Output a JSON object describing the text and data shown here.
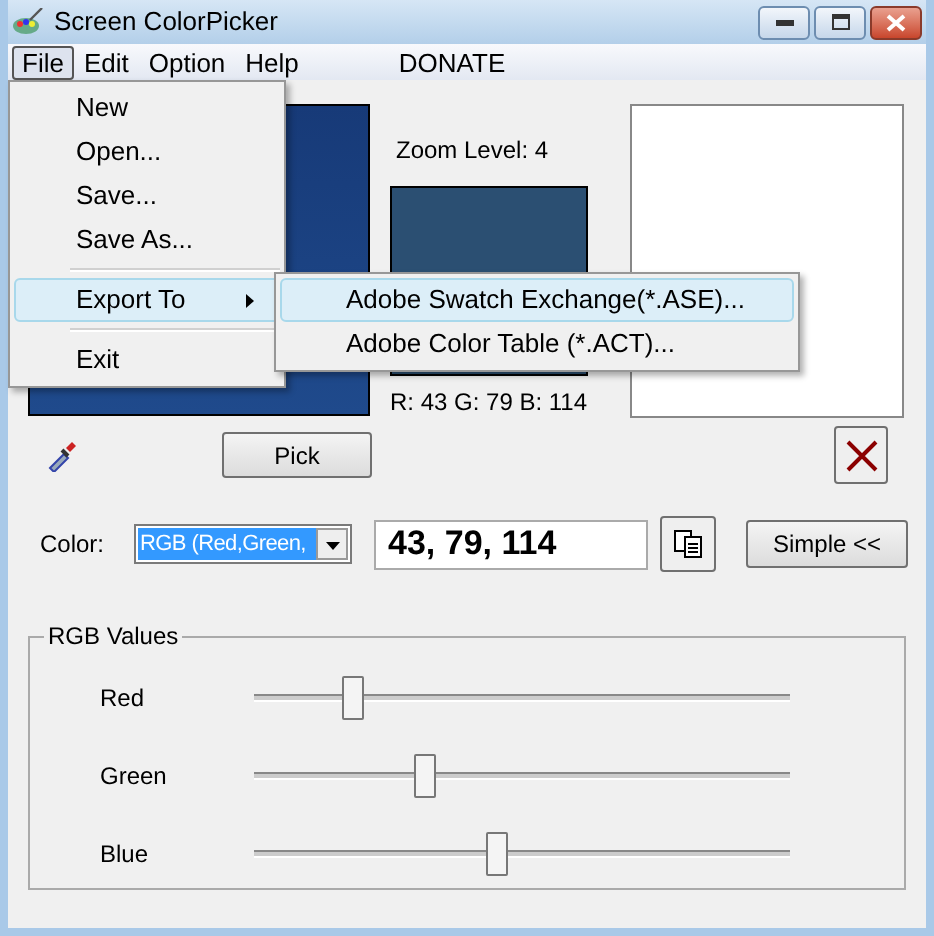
{
  "window": {
    "title": "Screen ColorPicker"
  },
  "menu_bar": [
    {
      "label": "File",
      "selected": true
    },
    {
      "label": "Edit",
      "selected": false
    },
    {
      "label": "Option",
      "selected": false
    },
    {
      "label": "Help",
      "selected": false
    },
    {
      "label": "DONATE",
      "selected": false
    }
  ],
  "file_menu": [
    {
      "kind": "item",
      "label": "New",
      "selected": false
    },
    {
      "kind": "item",
      "label": "Open...",
      "selected": false
    },
    {
      "kind": "item",
      "label": "Save...",
      "selected": false
    },
    {
      "kind": "item",
      "label": "Save As...",
      "selected": false
    },
    {
      "kind": "separator"
    },
    {
      "kind": "submenu",
      "label": "Export To",
      "selected": true
    },
    {
      "kind": "separator"
    },
    {
      "kind": "item",
      "label": "Exit",
      "selected": false
    }
  ],
  "export_submenu": [
    {
      "label": "Adobe Swatch Exchange(*.ASE)...",
      "selected": true
    },
    {
      "label": "Adobe Color Table (*.ACT)...",
      "selected": false
    }
  ],
  "preview": {
    "zoom_label": "Zoom Level: 4",
    "rgb_readout": "R: 43 G: 79 B: 114"
  },
  "pick_button": "Pick",
  "color_label": "Color:",
  "color_format": "RGB (Red,Green,",
  "color_value": "43, 79, 114",
  "simple_button": "Simple <<",
  "rgb_group": {
    "title": "RGB Values",
    "sliders": [
      {
        "label": "Red",
        "level": 0.17
      },
      {
        "label": "Green",
        "level": 0.31
      },
      {
        "label": "Blue",
        "level": 0.45
      }
    ]
  }
}
